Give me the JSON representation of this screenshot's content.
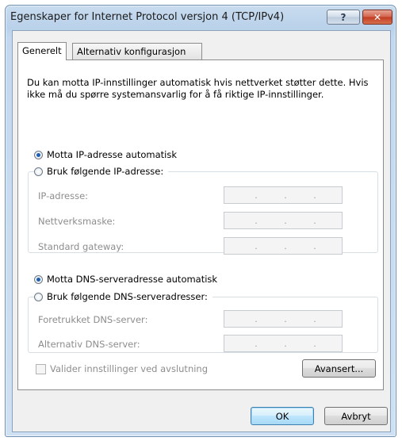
{
  "window": {
    "title": "Egenskaper for Internet Protocol versjon 4 (TCP/IPv4)",
    "help_label": "?",
    "close_label": "✕"
  },
  "tabs": [
    {
      "label": "Generelt",
      "selected": true
    },
    {
      "label": "Alternativ konfigurasjon",
      "selected": false
    }
  ],
  "description": "Du kan motta IP-innstillinger automatisk hvis nettverket støtter dette. Hvis ikke må du spørre systemansvarlig for å få riktige IP-innstillinger.",
  "ip_section": {
    "auto_label": "Motta IP-adresse automatisk",
    "auto_selected": true,
    "manual_label": "Bruk følgende IP-adresse:",
    "manual_selected": false,
    "fields": [
      {
        "label": "IP-adresse:",
        "value": ""
      },
      {
        "label": "Nettverksmaske:",
        "value": ""
      },
      {
        "label": "Standard gateway:",
        "value": ""
      }
    ]
  },
  "dns_section": {
    "auto_label": "Motta DNS-serveradresse automatisk",
    "auto_selected": true,
    "manual_label": "Bruk følgende DNS-serveradresser:",
    "manual_selected": false,
    "fields": [
      {
        "label": "Foretrukket DNS-server:",
        "value": ""
      },
      {
        "label": "Alternativ DNS-server:",
        "value": ""
      }
    ]
  },
  "validate_label": "Valider innstillinger ved avslutning",
  "validate_checked": false,
  "buttons": {
    "advanced": "Avansert...",
    "ok": "OK",
    "cancel": "Avbryt"
  },
  "colors": {
    "accent": "#1f5fb3",
    "disabled_text": "#8d8d8d"
  }
}
